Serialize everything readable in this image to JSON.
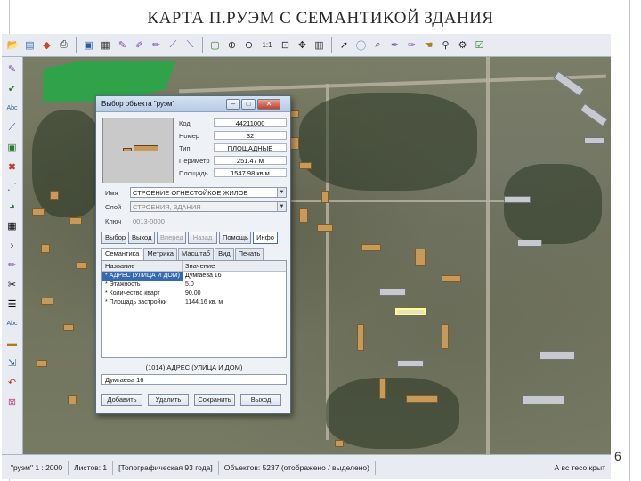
{
  "slide": {
    "title": "КАРТА П.РУЭМ С СЕМАНТИКОЙ ЗДАНИЯ",
    "page_number": "6"
  },
  "toolbar_top": {
    "icons": [
      "folder-open-icon",
      "layers-icon",
      "palette-icon",
      "print-icon",
      "save-icon",
      "table-icon",
      "pencil-icon",
      "edit-icon",
      "brush-icon",
      "ruler-icon",
      "measure-icon",
      "select-icon",
      "zoom-in-icon",
      "zoom-out-icon",
      "scale-1-1-icon",
      "zoom-fit-icon",
      "pan-icon",
      "grid-icon",
      "cursor-icon",
      "info-icon",
      "search-icon",
      "highlight-icon",
      "tool-icon",
      "settings-icon"
    ],
    "scale_label": "1:1"
  },
  "toolbar_left": {
    "icons": [
      "pen-icon",
      "check-icon",
      "text-abc-icon",
      "polyline-icon",
      "rectangle-icon",
      "close-x-icon",
      "node-icon",
      "circle-icon",
      "grid-icon",
      "arrow-icon",
      "pencil-icon",
      "scissors-icon",
      "list-icon",
      "text-abc-icon",
      "line-icon",
      "move-icon",
      "undo-icon",
      "delete-icon"
    ],
    "text_tool_label": "Abc"
  },
  "dialog": {
    "title": "Выбор объекта \"руэм\"",
    "controls": {
      "minimize": "–",
      "maximize": "□",
      "close": "✕"
    },
    "props": {
      "code_label": "Код",
      "code_value": "44211000",
      "number_label": "Номер",
      "number_value": "32",
      "type_label": "Тип",
      "type_value": "ПЛОЩАДНЫЕ",
      "perimeter_label": "Периметр",
      "perimeter_value": "251.47 м",
      "area_label": "Площадь",
      "area_value": "1547.98 кв.м"
    },
    "fields": {
      "name_label": "Имя",
      "name_value": "СТРОЕНИЕ ОГНЕСТОЙКОЕ ЖИЛОЕ",
      "layer_label": "Слой",
      "layer_value": "СТРОЕНИЯ, ЗДАНИЯ",
      "key_label": "Ключ",
      "key_value": "0013-0000"
    },
    "buttons": {
      "select": "Выбор",
      "exit": "Выход",
      "forward": "Вперед",
      "back": "Назад",
      "help": "Помощь",
      "info": "Инфо"
    },
    "tabs": [
      "Семантика",
      "Метрика",
      "Масштаб",
      "Вид",
      "Печать"
    ],
    "semantics": {
      "col_name": "Название",
      "col_value": "Значение",
      "rows": [
        {
          "name": "* АДРЕС (УЛИЦА И ДОМ)",
          "value": "Думгаева 16"
        },
        {
          "name": "* Этажность",
          "value": "5.0"
        },
        {
          "name": "* Количество кварт",
          "value": "90.00"
        },
        {
          "name": "* Площадь застройки",
          "value": "1144.16 кв. м"
        }
      ],
      "caption": "(1014) АДРЕС (УЛИЦА И ДОМ)",
      "edit_value": "Думгаева 16"
    },
    "bottom_buttons": {
      "add": "Добавить",
      "delete": "Удалить",
      "save": "Сохранить",
      "exit": "Выход"
    }
  },
  "status_bar": {
    "map_name": "\"руэм\" 1 : 2000",
    "sheet": "Листов: 1",
    "map_type": "[Топографическая 93 года]",
    "objects": "Объектов: 5237 (отображено / выделено)",
    "right": "А  вс  тесо  крыт"
  },
  "colors": {
    "field_green": "#2fa24a",
    "building_orange": "#c89a5a",
    "selection_blue": "#3569b2"
  }
}
